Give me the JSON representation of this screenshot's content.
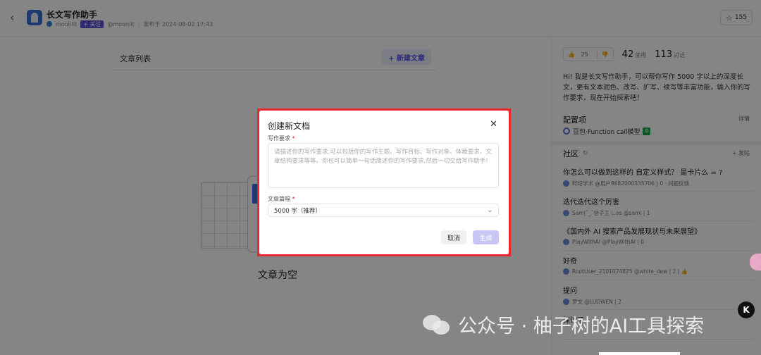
{
  "header": {
    "back_icon": "chevron-left-icon",
    "app_title": "长文写作助手",
    "author": "moonlit",
    "follow_label": "+ 关注",
    "handle": "@moonlit",
    "publish_date": "发布于 2024-08-02 17:43",
    "star_count": "155"
  },
  "left": {
    "list_title": "文章列表",
    "new_doc_label": "+  新建文章",
    "empty_text": "文章为空"
  },
  "sidebar": {
    "likes": "25",
    "uses_num": "42",
    "uses_unit": "使用",
    "convos_num": "113",
    "convos_unit": "对话",
    "description": "Hi! 我是长文写作助手，可以帮你写作 5000 字以上的深度长文，更有文本润色、改写、扩写、续写等丰富功能，输入你的写作要求，现在开始探索吧！",
    "config_title": "配置项",
    "config_detail": "详情",
    "model_label": "豆包·Function call模型",
    "community_title": "社区",
    "post_btn": "+ 发帖",
    "posts": [
      {
        "title": "你怎么可以做到这样的 自定义样式？ 是卡片么 = ?",
        "meta": "畔纪学术 @用户8682000335706 | 0 · 问题反馈"
      },
      {
        "title": "迭代迭代这个厉害",
        "meta": "Sam|ˇ_ˇ信子王 l..os @saml | 1"
      },
      {
        "title": "《国内外 AI 搜索产品发展现状与未来展望》",
        "meta": "PlayWithAI @PlayWithAI | 0"
      },
      {
        "title": "好奇",
        "meta": "RootUser_2101074825 @white_dew | 2 | 👍"
      },
      {
        "title": "提问",
        "meta": "罗文 @LUOWEN | 2"
      },
      {
        "title": "探讨了",
        "meta": ""
      }
    ]
  },
  "modal": {
    "title": "创建新文档",
    "close_icon": "close-icon",
    "req_label": "写作要求",
    "req_placeholder": "请描述你的写作要求,可以包括你的写作主题、写作目标、写作对象、体裁要求、文章结构要求等等。你也可以简单一句话简述你的写作要求,然后一切交给写作助手!",
    "length_label": "文章篇幅",
    "length_value": "5000 字（推荐）",
    "cancel_label": "取消",
    "generate_label": "生成"
  },
  "watermark": {
    "text": "公众号 · 柚子树的AI工具探索"
  },
  "badge": {
    "k_label": "K"
  },
  "colors": {
    "accent": "#5b55e6",
    "highlight_border": "#e8262c"
  }
}
